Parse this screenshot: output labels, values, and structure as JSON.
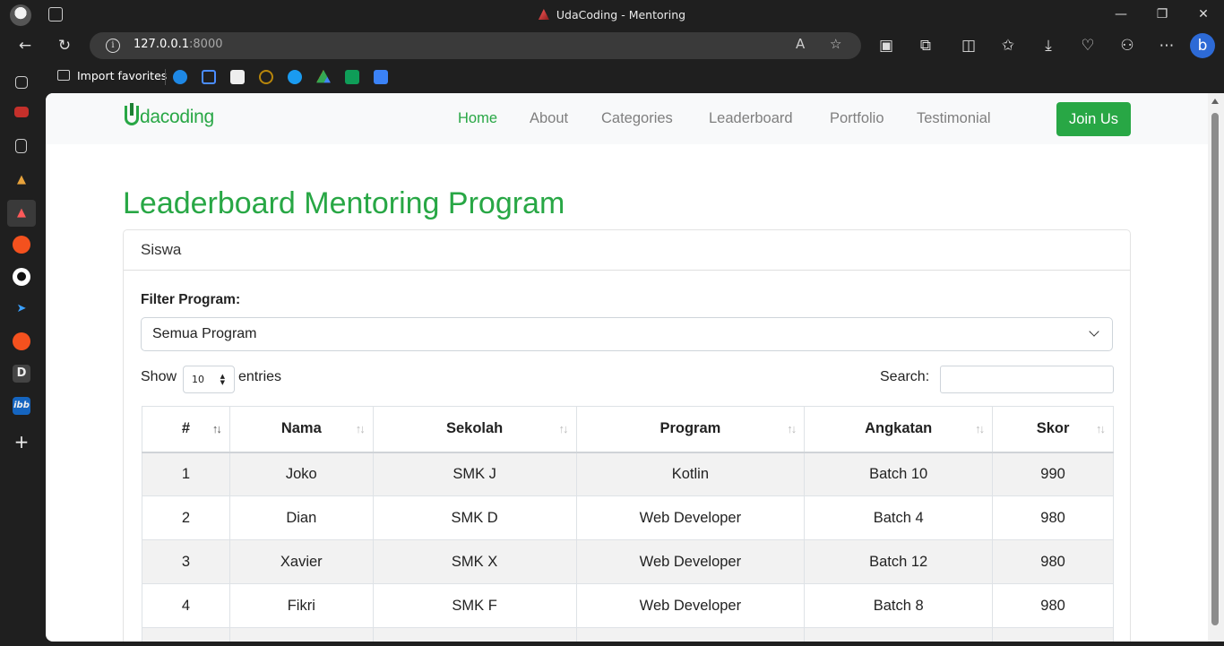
{
  "browser": {
    "window_title": "UdaCoding - Mentoring",
    "url_host": "127.0.0.1",
    "url_port": ":8000",
    "favorites": {
      "import_label": "Import favorites"
    },
    "window_controls": {
      "minimize": "—",
      "maximize": "❐",
      "close": "✕"
    }
  },
  "site": {
    "logo_text": "dacoding",
    "nav": [
      {
        "label": "Home",
        "active": true
      },
      {
        "label": "About"
      },
      {
        "label": "Categories"
      },
      {
        "label": "Leaderboard"
      },
      {
        "label": "Portfolio"
      },
      {
        "label": "Testimonial"
      }
    ],
    "cta": "Join Us",
    "accent_color": "#28a745"
  },
  "main": {
    "title": "Leaderboard Mentoring Program",
    "card_header": "Siswa",
    "filter_label": "Filter Program:",
    "filter_value": "Semua Program",
    "show_label": "Show",
    "page_length": "10",
    "entries_label": "entries",
    "search_label": "Search:",
    "search_value": ""
  },
  "table": {
    "columns": [
      "#",
      "Nama",
      "Sekolah",
      "Program",
      "Angkatan",
      "Skor"
    ],
    "rows": [
      [
        "1",
        "Joko",
        "SMK J",
        "Kotlin",
        "Batch 10",
        "990"
      ],
      [
        "2",
        "Dian",
        "SMK D",
        "Web Developer",
        "Batch 4",
        "980"
      ],
      [
        "3",
        "Xavier",
        "SMK X",
        "Web Developer",
        "Batch 12",
        "980"
      ],
      [
        "4",
        "Fikri",
        "SMK F",
        "Web Developer",
        "Batch 8",
        "980"
      ]
    ]
  }
}
